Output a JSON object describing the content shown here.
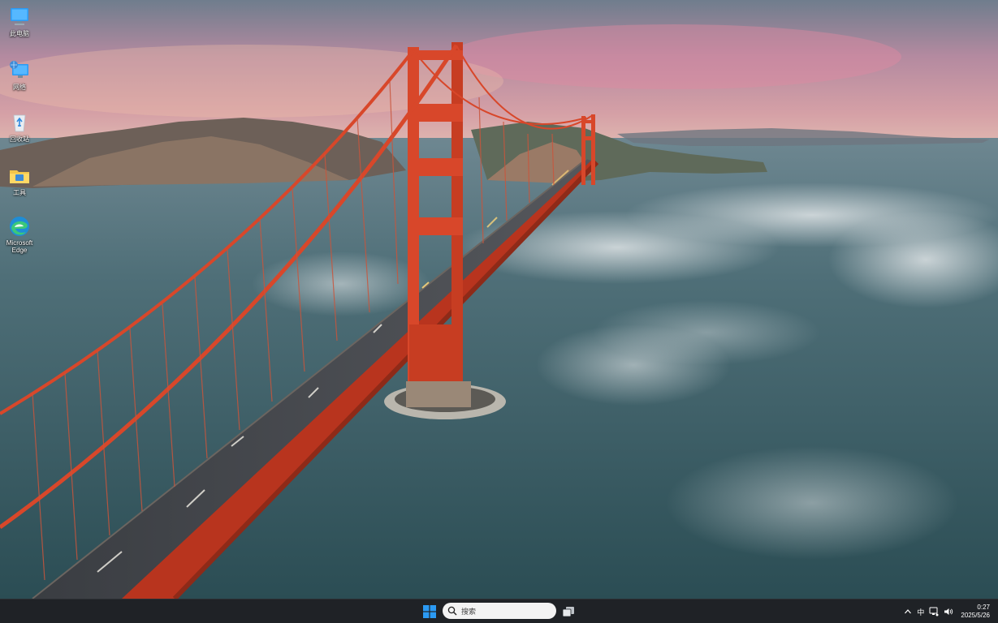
{
  "desktop": {
    "icons": [
      {
        "label": "此电脑",
        "icon": "this-pc-icon"
      },
      {
        "label": "网络",
        "icon": "network-icon"
      },
      {
        "label": "回收站",
        "icon": "recycle-bin-icon"
      },
      {
        "label": "工具",
        "icon": "folder-icon"
      },
      {
        "label": "Microsoft Edge",
        "icon": "edge-icon"
      }
    ]
  },
  "taskbar": {
    "search_placeholder": "搜索",
    "tray": {
      "ime_label": "中",
      "time": "0:27",
      "date": "2025/5/26"
    }
  },
  "colors": {
    "taskbar_bg": "#1f2226",
    "windows_blue": "#2b9af3",
    "bridge_red": "#d8472a"
  }
}
